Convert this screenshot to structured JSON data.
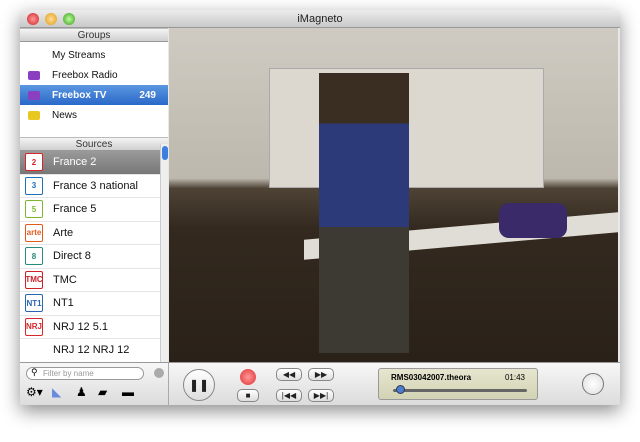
{
  "window": {
    "title": "iMagneto"
  },
  "groups": {
    "header": "Groups",
    "items": [
      {
        "label": "My Streams",
        "icon": "none"
      },
      {
        "label": "Freebox Radio",
        "icon": "purple-folder-icon"
      },
      {
        "label": "Freebox TV",
        "icon": "purple-folder-icon",
        "count": "249",
        "selected": true
      },
      {
        "label": "News",
        "icon": "yellow-folder-icon"
      }
    ]
  },
  "sources": {
    "header": "Sources",
    "items": [
      {
        "label": "France 2",
        "logo": "2",
        "color": "#d8262b",
        "selected": true
      },
      {
        "label": "France 3 national",
        "logo": "3",
        "color": "#1f6fb4"
      },
      {
        "label": "France 5",
        "logo": "5",
        "color": "#7cb82f"
      },
      {
        "label": "Arte",
        "logo": "arte",
        "color": "#e35b1c"
      },
      {
        "label": "Direct 8",
        "logo": "8",
        "color": "#2a8a7a"
      },
      {
        "label": "TMC",
        "logo": "TMC",
        "color": "#d0202a"
      },
      {
        "label": "NT1",
        "logo": "NT1",
        "color": "#2a66b0"
      },
      {
        "label": "NRJ 12 5.1",
        "logo": "NRJ",
        "color": "#d8262b"
      },
      {
        "label": "NRJ 12 NRJ 12",
        "logo": "",
        "color": "#fff"
      }
    ]
  },
  "filter": {
    "placeholder": "Filter by name"
  },
  "player": {
    "filename": "RMS03042007.theora",
    "time": "01:43",
    "progress": 0.05
  },
  "buttons": {
    "rewind": "◀◀",
    "ffwd": "▶▶",
    "prev": "|◀◀",
    "next": "▶▶|",
    "pause": "❚❚",
    "stop": "■"
  }
}
